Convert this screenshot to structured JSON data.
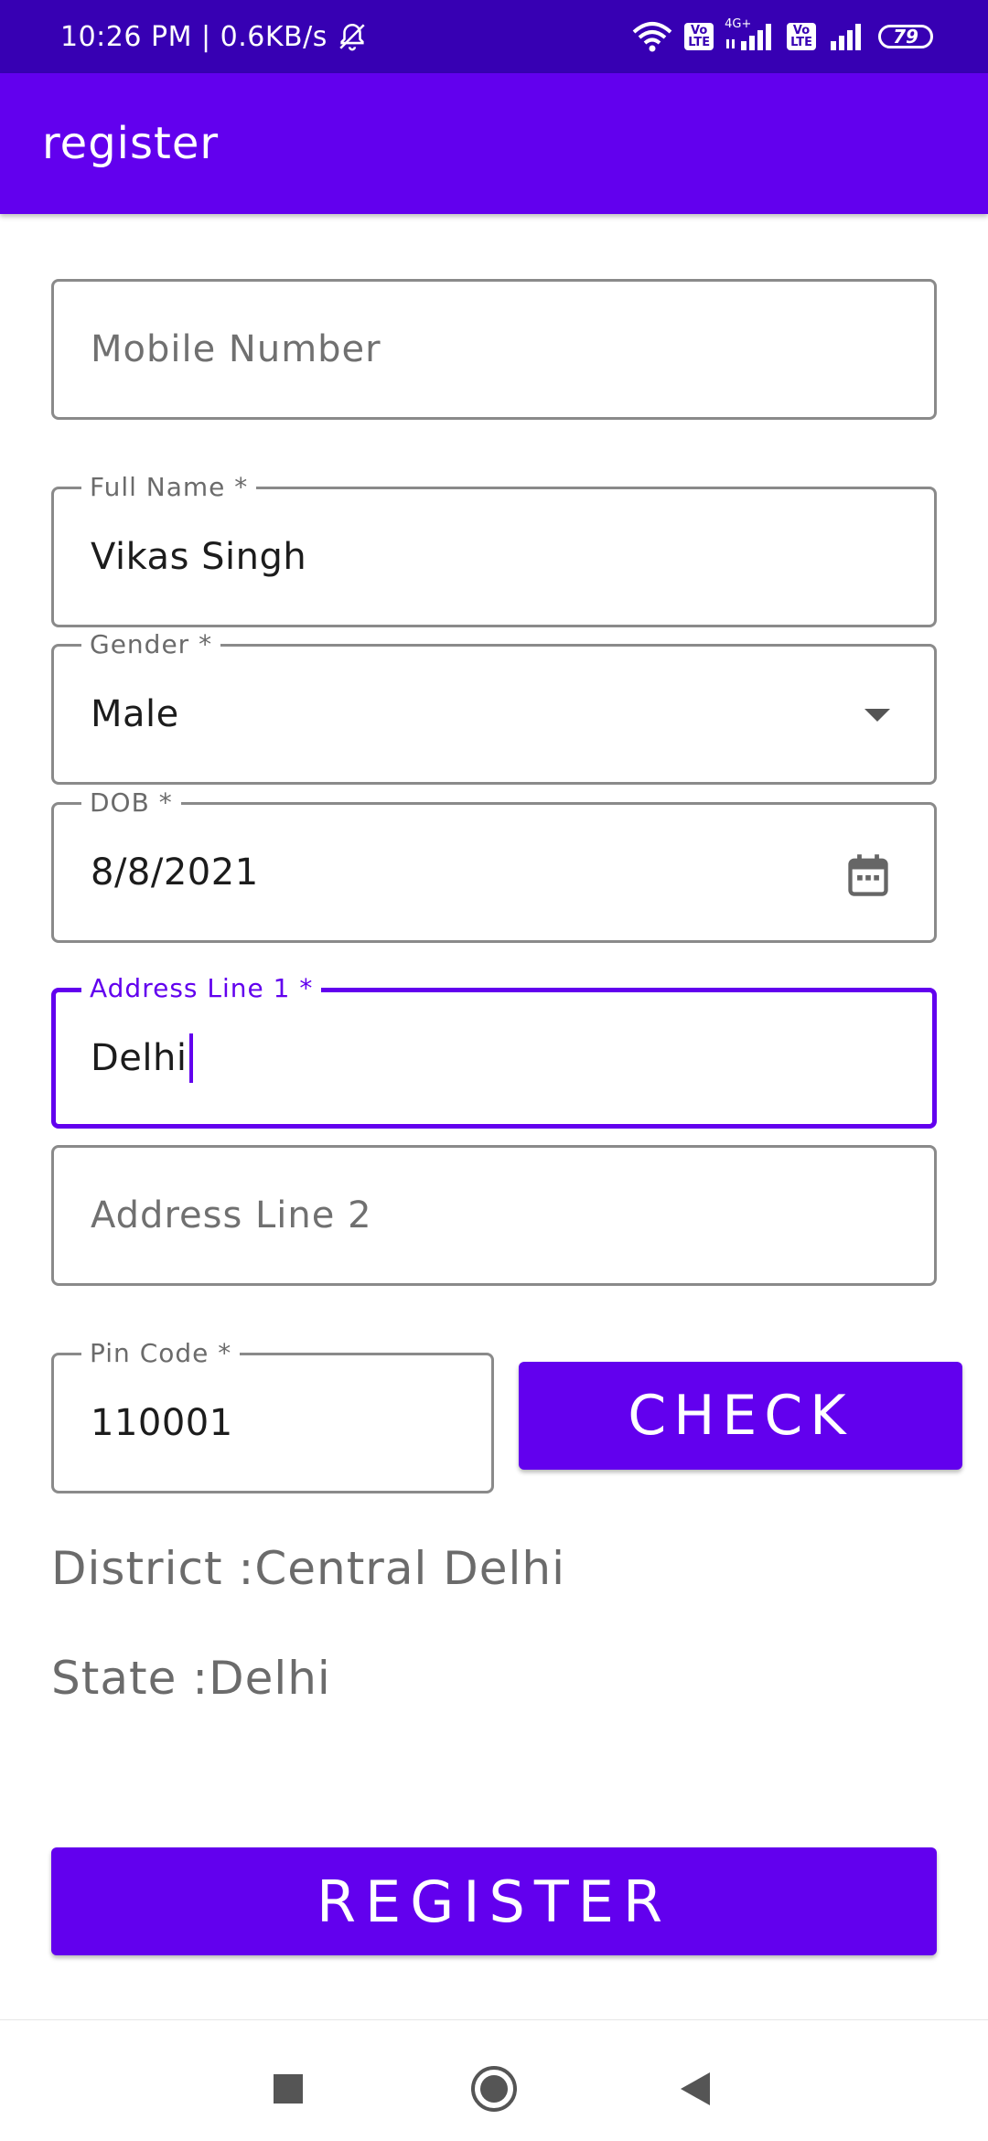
{
  "status_bar": {
    "time_speed": "10:26 PM | 0.6KB/s",
    "volte_label": "Vo\nLTE",
    "network_label": "4G+",
    "battery": "79"
  },
  "app_bar": {
    "title": "register"
  },
  "form": {
    "mobile": {
      "placeholder": "Mobile Number",
      "value": ""
    },
    "full_name": {
      "label": "Full Name *",
      "value": "Vikas Singh"
    },
    "gender": {
      "label": "Gender *",
      "value": "Male"
    },
    "dob": {
      "label": "DOB *",
      "value": "8/8/2021"
    },
    "address1": {
      "label": "Address Line 1 *",
      "value": "Delhi"
    },
    "address2": {
      "placeholder": "Address Line 2",
      "value": ""
    },
    "pincode": {
      "label": "Pin Code *",
      "value": "110001"
    },
    "check_button": "CHECK",
    "district": "District :Central Delhi",
    "state": "State :Delhi",
    "register_button": "REGISTER"
  },
  "colors": {
    "status_bar": "#3700b3",
    "primary": "#6200ee",
    "outline": "#8a8a8a"
  },
  "icons": {
    "status": [
      "mute-bell-icon",
      "wifi-icon",
      "volte-icon",
      "signal-icon",
      "battery-icon"
    ],
    "fields": [
      "dropdown-arrow-icon",
      "calendar-icon"
    ],
    "nav": [
      "recents-square-icon",
      "home-circle-icon",
      "back-triangle-icon"
    ]
  }
}
